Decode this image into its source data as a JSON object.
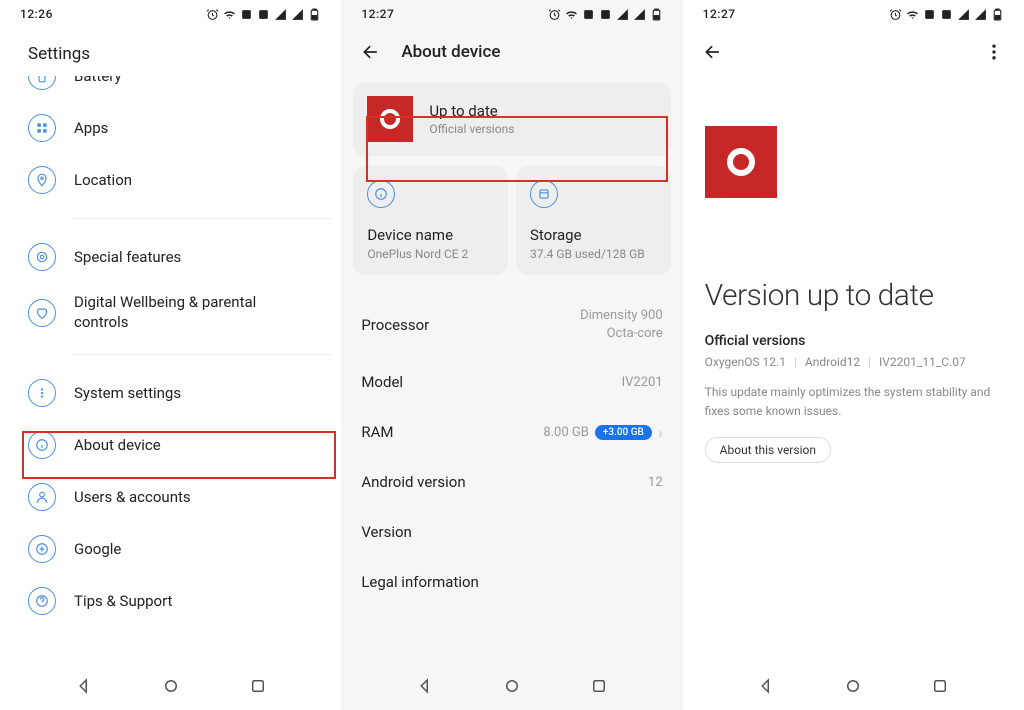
{
  "phone1": {
    "status_time": "12:26",
    "header": "Settings",
    "items": [
      {
        "label": "Battery"
      },
      {
        "label": "Apps"
      },
      {
        "label": "Location"
      },
      {
        "label": "Special features"
      },
      {
        "label": "Digital Wellbeing & parental controls"
      },
      {
        "label": "System settings"
      },
      {
        "label": "About device"
      },
      {
        "label": "Users & accounts"
      },
      {
        "label": "Google"
      },
      {
        "label": "Tips & Support"
      }
    ]
  },
  "phone2": {
    "status_time": "12:27",
    "header": "About device",
    "update_card": {
      "title": "Up to date",
      "subtitle": "Official versions"
    },
    "device_name_card": {
      "title": "Device name",
      "value": "OnePlus Nord CE 2"
    },
    "storage_card": {
      "title": "Storage",
      "value": "37.4 GB used/128 GB"
    },
    "specs": {
      "processor": {
        "label": "Processor",
        "value_line1": "Dimensity 900",
        "value_line2": "Octa-core"
      },
      "model": {
        "label": "Model",
        "value": "IV2201"
      },
      "ram": {
        "label": "RAM",
        "value": "8.00 GB",
        "badge": "+3.00 GB"
      },
      "android": {
        "label": "Android version",
        "value": "12"
      },
      "version": {
        "label": "Version"
      },
      "legal": {
        "label": "Legal information"
      }
    }
  },
  "phone3": {
    "status_time": "12:27",
    "title": "Version up to date",
    "subtitle": "Official versions",
    "meta": {
      "os": "OxygenOS 12.1",
      "android": "Android12",
      "build": "IV2201_11_C.07"
    },
    "description": "This update mainly optimizes the system stability and fixes some known issues.",
    "button": "About this version"
  }
}
